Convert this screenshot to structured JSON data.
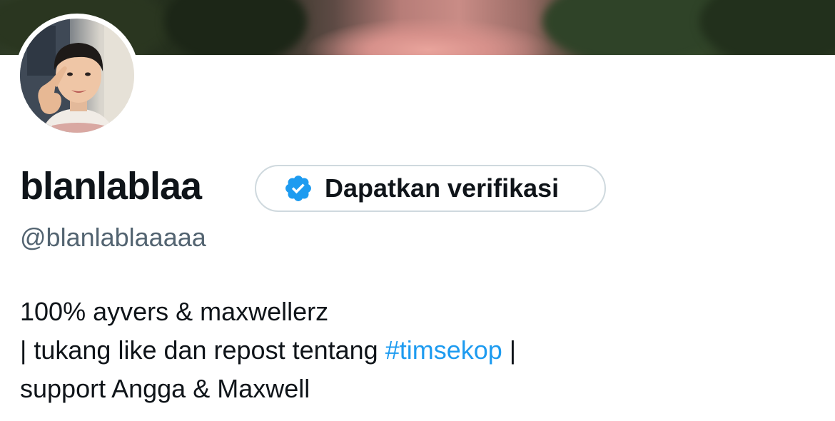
{
  "profile": {
    "display_name": "blanlablaa",
    "handle": "@blanlablaaaaa",
    "verify_button_label": "Dapatkan verifikasi",
    "bio": {
      "line1": "100% ayvers & maxwellerz",
      "line2_prefix": "| tukang like dan repost tentang ",
      "line2_hashtag": "#timsekop",
      "line2_suffix": " |",
      "line3": "support Angga & Maxwell"
    }
  },
  "icons": {
    "verify_badge": "verified-badge-icon",
    "avatar": "profile-photo"
  },
  "colors": {
    "accent": "#1d9bf0",
    "text_primary": "#0f1419",
    "text_secondary": "#536471",
    "border": "#cfd9de"
  }
}
